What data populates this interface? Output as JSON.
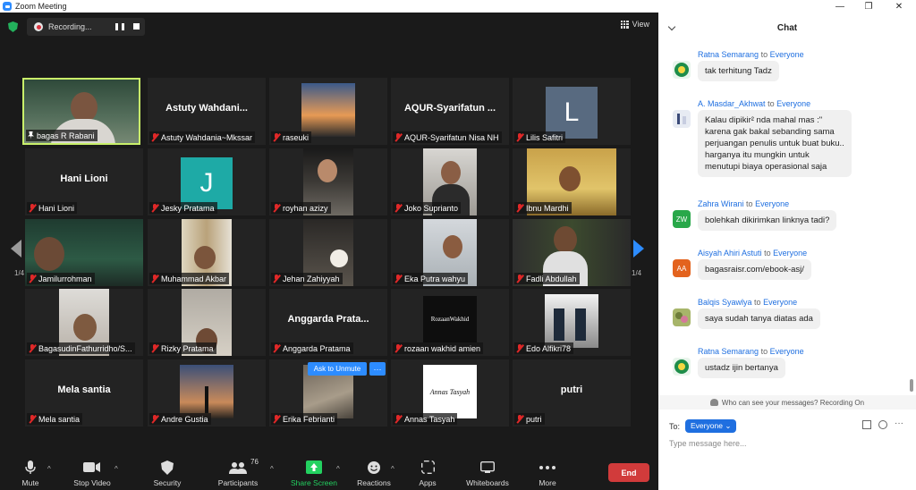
{
  "window": {
    "title": "Zoom Meeting",
    "controls": [
      "—",
      "❐",
      "✕"
    ]
  },
  "recording": {
    "label": "Recording..."
  },
  "view": {
    "label": "View"
  },
  "pager": {
    "page": "1/4"
  },
  "participants": [
    {
      "name": "bagas R Rabani",
      "pinned": true,
      "active": true
    },
    {
      "name": "Astuty Wahdania~Mkssar",
      "bigname": "Astuty  Wahdani..."
    },
    {
      "name": "raseuki"
    },
    {
      "name": "AQUR-Syarifatun Nisa NH",
      "bigname": "AQUR-Syarifatun ..."
    },
    {
      "name": "Lilis Safitri",
      "avatar": "L",
      "avatar_color": "#586a80"
    },
    {
      "name": "Hani Lioni",
      "bigname": "Hani Lioni"
    },
    {
      "name": "Jesky Pratama",
      "avatar": "J",
      "avatar_color": "#1eaaa6"
    },
    {
      "name": "royhan azizy"
    },
    {
      "name": "Joko Suprianto"
    },
    {
      "name": "Ibnu Mardhi"
    },
    {
      "name": "Jamilurrohman"
    },
    {
      "name": "Muhammad Akbar"
    },
    {
      "name": "Jehan Zahiyyah"
    },
    {
      "name": "Eka Putra wahyu"
    },
    {
      "name": "Fadli Abdullah"
    },
    {
      "name": "BagasudinFathurridho/S...",
      "photo": true
    },
    {
      "name": "Rizky Pratama"
    },
    {
      "name": "Anggarda Pratama",
      "bigname": "Anggarda  Prata..."
    },
    {
      "name": "rozaan wakhid amien"
    },
    {
      "name": "Edo Alfikri78"
    },
    {
      "name": "Mela santia",
      "bigname": "Mela santia"
    },
    {
      "name": "Andre Gustia"
    },
    {
      "name": "Erika Febrianti"
    },
    {
      "name": "Annas Tasyah"
    },
    {
      "name": "putri",
      "bigname": "putri"
    }
  ],
  "logo_text": {
    "rozaan": "RozaanWakhid",
    "annas": "Annas Tasyah"
  },
  "hover": {
    "unmute": "Ask to Unmute",
    "more": "···"
  },
  "toolbar": {
    "mute": "Mute",
    "video": "Stop Video",
    "security": "Security",
    "participants": "Participants",
    "participants_count": "76",
    "share": "Share Screen",
    "reactions": "Reactions",
    "apps": "Apps",
    "whiteboards": "Whiteboards",
    "more": "More",
    "end": "End"
  },
  "chat": {
    "title": "Chat",
    "messages": [
      {
        "from": "Ratna Semarang",
        "to": "to",
        "target": "Everyone",
        "text": "tak terhitung Tadz"
      },
      {
        "from": "A. Masdar_Akhwat",
        "to": "to",
        "target": "Everyone",
        "text": "Kalau dipikir² nda mahal mas :\"\nkarena gak bakal sebanding sama\nperjuangan penulis untuk buat buku..\nharganya itu mungkin untuk\nmenutupi biaya operasional saja"
      },
      {
        "from": "Zahra Wirani",
        "to": "to",
        "target": "Everyone",
        "text": "bolehkah dikirimkan linknya tadi?",
        "initials": "ZW"
      },
      {
        "from": "Aisyah Ahiri Astuti",
        "to": "to",
        "target": "Everyone",
        "text": "bagasraisr.com/ebook-asj/",
        "initials": "AA"
      },
      {
        "from": "Balqis Syawlya",
        "to": "to",
        "target": "Everyone",
        "text": "saya sudah tanya diatas ada"
      },
      {
        "from": "Ratna Semarang",
        "to": "to",
        "target": "Everyone",
        "text": "ustadz ijin bertanya"
      }
    ],
    "privacy": "Who can see your messages? Recording On",
    "to_label": "To:",
    "to_value": "Everyone",
    "placeholder": "Type message here..."
  },
  "colors": {
    "accent": "#2d8cff",
    "active_border": "#c9f06a",
    "end": "#d13b3b",
    "share_green": "#23d160",
    "mute_red": "#e02828"
  }
}
